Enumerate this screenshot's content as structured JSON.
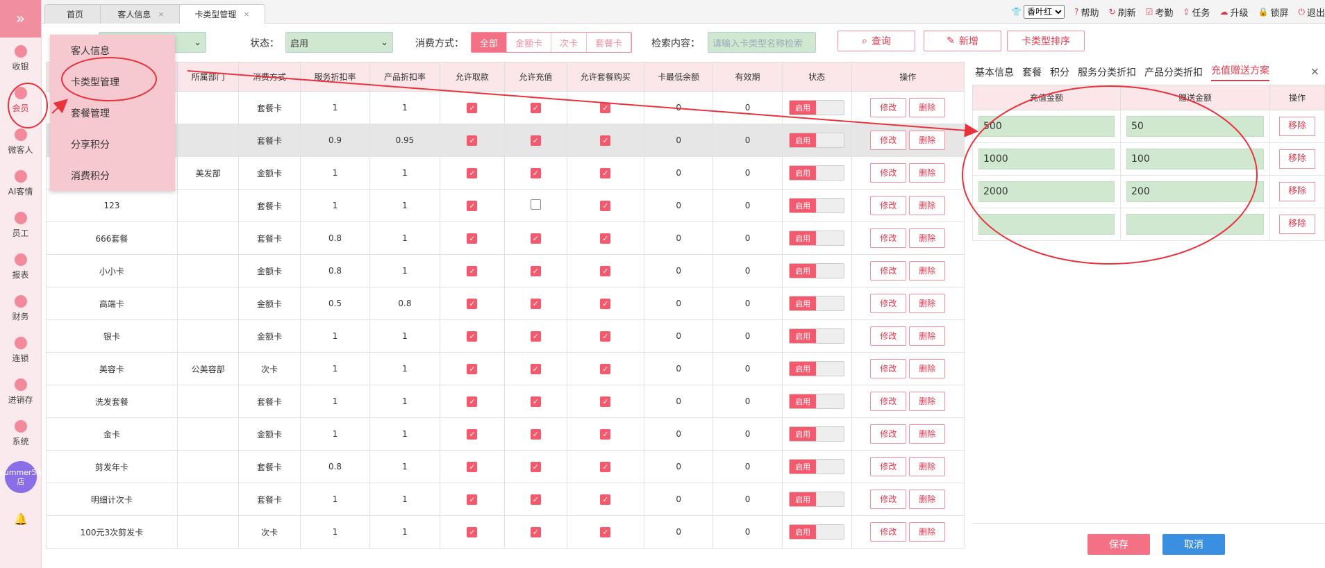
{
  "sidebar": {
    "logo": "»",
    "items": [
      {
        "label": "收银",
        "icon": "money-bag-icon"
      },
      {
        "label": "会员",
        "icon": "diamond-icon"
      },
      {
        "label": "微客人",
        "icon": "people-icon"
      },
      {
        "label": "AI客情",
        "icon": "ai-icon"
      },
      {
        "label": "员工",
        "icon": "user-icon"
      },
      {
        "label": "报表",
        "icon": "monitor-icon"
      },
      {
        "label": "财务",
        "icon": "pie-icon"
      },
      {
        "label": "连锁",
        "icon": "shop-icon"
      },
      {
        "label": "进销存",
        "icon": "house-icon"
      },
      {
        "label": "系统",
        "icon": "gear-icon"
      }
    ],
    "avatar": "summer5A店"
  },
  "tabs": [
    {
      "label": "首页"
    },
    {
      "label": "客人信息",
      "close": "×"
    },
    {
      "label": "卡类型管理",
      "close": "×"
    }
  ],
  "toolbar": {
    "user": "香叶红",
    "help": "帮助",
    "refresh": "刷新",
    "attendance": "考勤",
    "task": "任务",
    "upgrade": "升级",
    "lock": "锁屏",
    "logout": "退出"
  },
  "filters": {
    "status_label": "状态：",
    "status_value": "启用",
    "consume_label": "消费方式：",
    "segs": [
      "全部",
      "金额卡",
      "次卡",
      "套餐卡"
    ],
    "search_label": "检索内容：",
    "search_placeholder": "请输入卡类型名称检索",
    "query": "查询",
    "add": "新增",
    "sort": "卡类型排序"
  },
  "menu": [
    "客人信息",
    "卡类型管理",
    "套餐管理",
    "分享积分",
    "消费积分"
  ],
  "table": {
    "headers": [
      "",
      "所属部门",
      "消费方式",
      "服务折扣率",
      "产品折扣率",
      "允许取款",
      "允许充值",
      "允许套餐购买",
      "卡最低余额",
      "有效期",
      "状态",
      "操作"
    ],
    "toggle": "启用",
    "edit": "修改",
    "del": "删除",
    "rows": [
      [
        "",
        "",
        "套餐卡",
        "1",
        "1",
        1,
        1,
        1,
        "0",
        "0"
      ],
      [
        "",
        "",
        "套餐卡",
        "0.9",
        "0.95",
        1,
        1,
        1,
        "0",
        "0"
      ],
      [
        "",
        "美发部",
        "金额卡",
        "1",
        "1",
        1,
        1,
        1,
        "0",
        "0"
      ],
      [
        "123",
        "",
        "套餐卡",
        "1",
        "1",
        1,
        0,
        1,
        "0",
        "0"
      ],
      [
        "666套餐",
        "",
        "套餐卡",
        "0.8",
        "1",
        1,
        1,
        1,
        "0",
        "0"
      ],
      [
        "小小卡",
        "",
        "金额卡",
        "0.8",
        "1",
        1,
        1,
        1,
        "0",
        "0"
      ],
      [
        "高端卡",
        "",
        "金额卡",
        "0.5",
        "0.8",
        1,
        1,
        1,
        "0",
        "0"
      ],
      [
        "银卡",
        "",
        "金额卡",
        "1",
        "1",
        1,
        1,
        1,
        "0",
        "0"
      ],
      [
        "美容卡",
        "公美容部",
        "次卡",
        "1",
        "1",
        1,
        1,
        1,
        "0",
        "0"
      ],
      [
        "洗发套餐",
        "",
        "套餐卡",
        "1",
        "1",
        1,
        1,
        1,
        "0",
        "0"
      ],
      [
        "金卡",
        "",
        "金额卡",
        "1",
        "1",
        1,
        1,
        1,
        "0",
        "0"
      ],
      [
        "剪发年卡",
        "",
        "套餐卡",
        "0.8",
        "1",
        1,
        1,
        1,
        "0",
        "0"
      ],
      [
        "明细计次卡",
        "",
        "套餐卡",
        "1",
        "1",
        1,
        1,
        1,
        "0",
        "0"
      ],
      [
        "100元3次剪发卡",
        "",
        "次卡",
        "1",
        "1",
        1,
        1,
        1,
        "0",
        "0"
      ]
    ]
  },
  "panel": {
    "tabs": [
      "基本信息",
      "套餐",
      "积分",
      "服务分类折扣",
      "产品分类折扣",
      "充值赠送方案"
    ],
    "close": "×",
    "headers": [
      "充值金额",
      "赠送金额",
      "操作"
    ],
    "remove": "移除",
    "rows": [
      [
        "500",
        "50"
      ],
      [
        "1000",
        "100"
      ],
      [
        "2000",
        "200"
      ],
      [
        "",
        ""
      ]
    ],
    "save": "保存",
    "cancel": "取消"
  },
  "colors": {
    "accent": "#f47085",
    "annotation": "#e8323c",
    "input_green": "#cfe8cf"
  }
}
